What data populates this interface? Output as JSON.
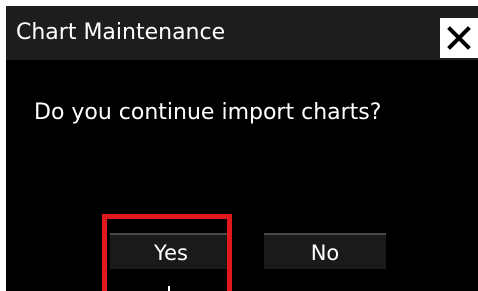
{
  "dialog": {
    "title": "Chart Maintenance",
    "message": "Do you continue import charts?",
    "close_icon": "close-icon",
    "buttons": {
      "yes_label": "Yes",
      "no_label": "No"
    }
  },
  "highlight": {
    "target": "yes-button",
    "color": "#e0191f"
  }
}
